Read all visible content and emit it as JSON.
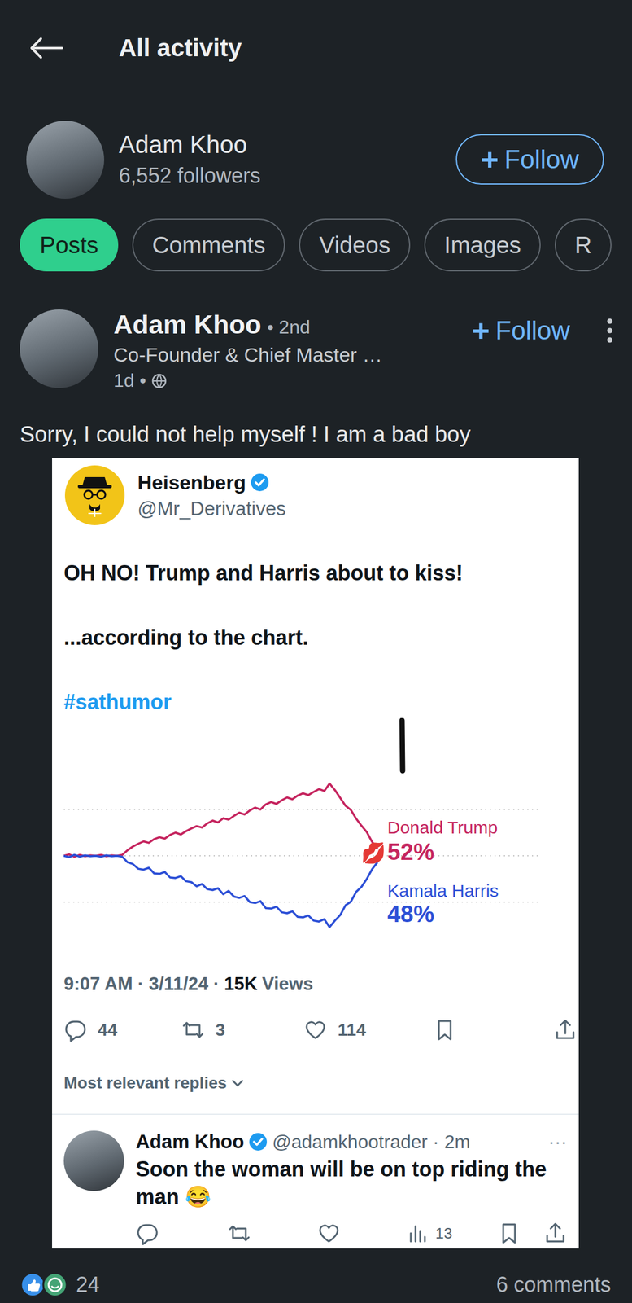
{
  "header": {
    "title": "All activity"
  },
  "profile": {
    "name": "Adam Khoo",
    "followers": "6,552 followers",
    "follow_icon": "+",
    "follow": "Follow"
  },
  "tabs": [
    {
      "label": "Posts",
      "selected": true
    },
    {
      "label": "Comments",
      "selected": false
    },
    {
      "label": "Videos",
      "selected": false
    },
    {
      "label": "Images",
      "selected": false
    },
    {
      "label": "R",
      "selected": false
    }
  ],
  "post": {
    "author": "Adam Khoo",
    "degree": "• 2nd",
    "headline": "Co-Founder & Chief Master …",
    "time": "1d •",
    "follow_icon": "+",
    "follow": "Follow",
    "text": "Sorry, I could not help myself ! I am a bad boy"
  },
  "tweet": {
    "name": "Heisenberg",
    "handle": "@Mr_Derivatives",
    "headline": "OH NO! Trump and Harris about to kiss!",
    "subline": "...according to the chart.",
    "hashtag": "#sathumor",
    "chart": {
      "marker": "💋",
      "series": [
        {
          "name": "Donald Trump",
          "value": "52%",
          "color": "#c5245e",
          "values": [
            50,
            50.3,
            49.8,
            50.2,
            49.9,
            50.1,
            50,
            50.2,
            49.9,
            50.1,
            50,
            50.2,
            51.2,
            52.0,
            52.6,
            53.1,
            52.8,
            53.6,
            54.0,
            53.7,
            54.5,
            55.0,
            54.6,
            55.3,
            55.9,
            56.4,
            56.1,
            57.0,
            57.6,
            57.2,
            58.1,
            57.8,
            58.6,
            59.3,
            58.9,
            59.8,
            60.4,
            60.0,
            61.1,
            61.6,
            61.2,
            62.0,
            62.6,
            62.2,
            63.0,
            63.5,
            63.1,
            63.8,
            64.4,
            64.0,
            65.6,
            64.2,
            62.5,
            60.8,
            59.9,
            58.0,
            56.5,
            55.1,
            53.0,
            51.5
          ]
        },
        {
          "name": "Kamala Harris",
          "value": "48%",
          "color": "#2c4fd6",
          "values": [
            50,
            49.7,
            50.2,
            49.8,
            50.1,
            49.9,
            50,
            49.8,
            50.1,
            49.9,
            50,
            49.8,
            48.6,
            48.2,
            47.2,
            47.0,
            47.4,
            46.2,
            46.1,
            46.5,
            45.3,
            45.2,
            45.6,
            44.5,
            44.3,
            43.4,
            43.9,
            42.8,
            42.6,
            43.0,
            41.7,
            42.4,
            41.2,
            40.9,
            41.3,
            40.0,
            39.8,
            40.2,
            38.7,
            38.6,
            39.0,
            37.8,
            37.6,
            38.0,
            36.8,
            36.7,
            37.1,
            36.0,
            35.8,
            36.3,
            34.6,
            36.0,
            37.2,
            39.3,
            40.1,
            42.2,
            43.3,
            45.0,
            47.1,
            48.6
          ]
        }
      ]
    },
    "time": "9:07 AM · 3/11/24 ·",
    "views_count": "15K",
    "views_label": "Views",
    "stats": {
      "replies": "44",
      "reposts": "3",
      "likes": "114"
    },
    "replies_filter": "Most relevant replies",
    "reply": {
      "name": "Adam Khoo",
      "handle": "@adamkhootrader · 2m",
      "more": "···",
      "text": "Soon the woman will be on top  riding the man 😂",
      "views": "13"
    }
  },
  "footer": {
    "reactions": "24",
    "comments": "6 comments"
  }
}
